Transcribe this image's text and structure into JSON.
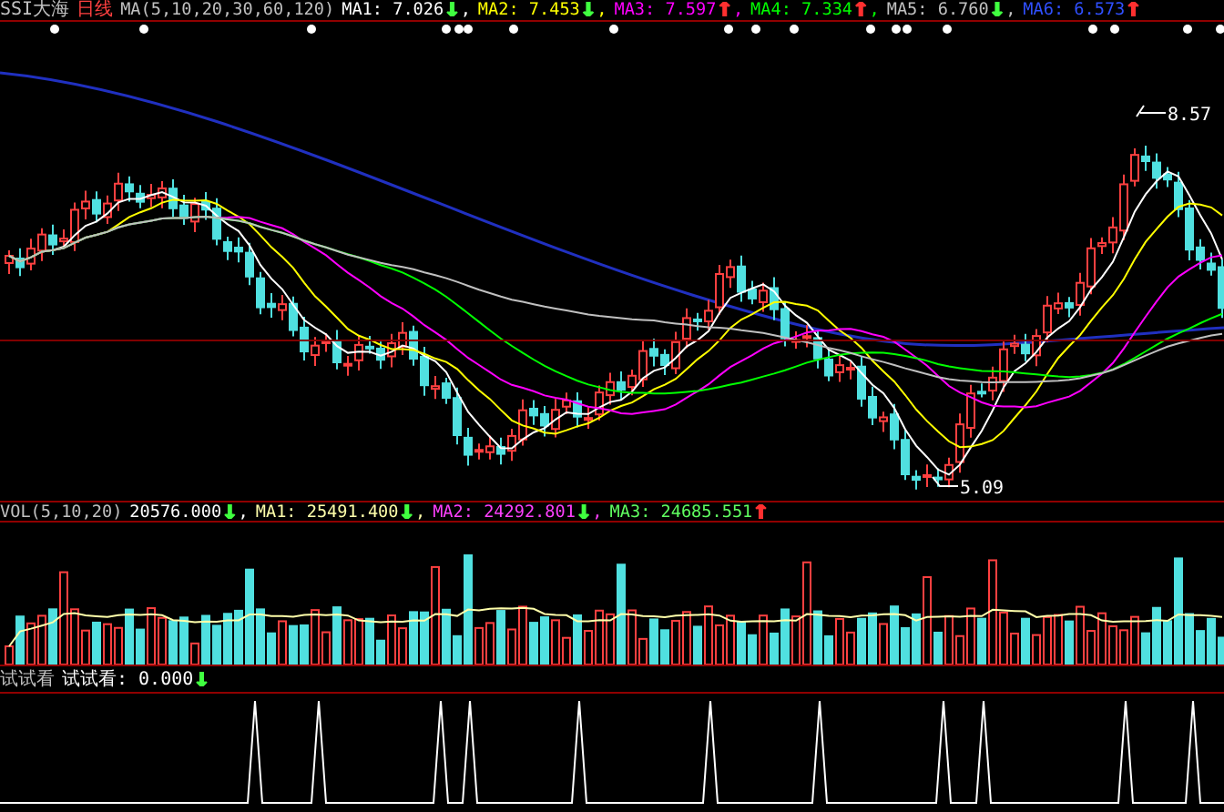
{
  "header": {
    "name": "SSI大海",
    "period": "日线",
    "params": "MA(5,10,20,30,60,120)",
    "readings": [
      {
        "text": "MA1: 7.026",
        "arrow": {
          "text": "↓",
          "color": "#40ff40"
        },
        "sep": ",",
        "color": "#ffffff"
      },
      {
        "text": "MA2: 7.453",
        "arrow": {
          "text": "↓",
          "color": "#40ff40"
        },
        "sep": ",",
        "color": "#ffff00"
      },
      {
        "text": "MA3: 7.597",
        "arrow": {
          "text": "↑",
          "color": "#ff3030"
        },
        "sep": ",",
        "color": "#ff00ff"
      },
      {
        "text": "MA4: 7.334",
        "arrow": {
          "text": "↑",
          "color": "#ff3030"
        },
        "sep": ",",
        "color": "#00ff00"
      },
      {
        "text": "MA5: 6.760",
        "arrow": {
          "text": "↓",
          "color": "#40ff40"
        },
        "sep": ",",
        "color": "#c0c0c0"
      },
      {
        "text": "MA6: 6.573",
        "arrow": {
          "text": "↑",
          "color": "#ff3030"
        },
        "color": "#3050ff"
      }
    ]
  },
  "price_marks": {
    "high": "8.57",
    "low": "5.09"
  },
  "volume": {
    "params": "VOL(5,10,20)",
    "value": "20576.000",
    "arrow": {
      "text": "↓",
      "color": "#40ff40"
    },
    "sep": ",",
    "readings": [
      {
        "text": "MA1: 25491.400",
        "arrow": {
          "text": "↓",
          "color": "#40ff40"
        },
        "sep": ",",
        "color": "#ffffaa"
      },
      {
        "text": "MA2: 24292.801",
        "arrow": {
          "text": "↓",
          "color": "#40ff40"
        },
        "sep": ",",
        "color": "#ff40ff"
      },
      {
        "text": "MA3: 24685.551",
        "arrow": {
          "text": "↑",
          "color": "#ff3030"
        },
        "color": "#60ff60"
      }
    ]
  },
  "indicator": {
    "name": "试试看",
    "label": "试试看: 0.000",
    "arrow": {
      "text": "↓",
      "color": "#40ff40"
    }
  }
}
